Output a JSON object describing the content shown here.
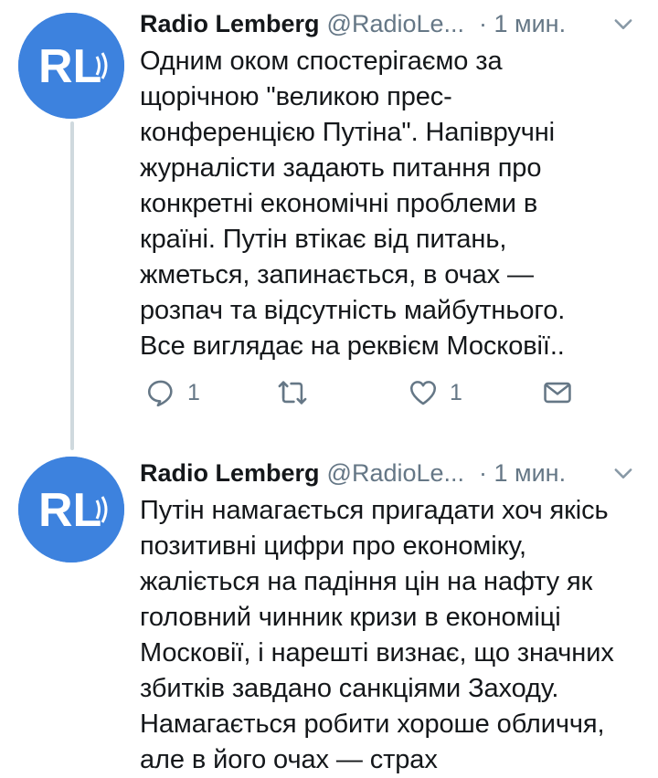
{
  "tweets": [
    {
      "avatar_text": "RL",
      "name": "Radio Lemberg",
      "handle": "@RadioLe...",
      "time": "· 1 мин.",
      "text": "Одним оком спостерігаємо за\nщорічною \"великою прес-\nконференцією Путіна\". Напівручні\nжурналісти задають питання про\nконкретні економічні проблеми в\nкраїні. Путін втікає від питань,\nжметься, запинається, в очах —\nрозпач та відсутність майбутнього.\nВсе виглядає на реквієм Московії..",
      "actions": {
        "reply_icon": "reply-icon",
        "reply_count": "1",
        "retweet_icon": "retweet-icon",
        "retweet_count": "",
        "like_icon": "like-icon",
        "like_count": "1",
        "dm_icon": "message-icon"
      }
    },
    {
      "avatar_text": "RL",
      "name": "Radio Lemberg",
      "handle": "@RadioLe...",
      "time": "· 1 мин.",
      "text": "Путін намагається пригадати хоч якісь\nпозитивні цифри про економіку,\nжаліється на падіння цін на нафту як\nголовний чинник кризи в економіці\nМосковії, і нарешті визнає, що значних\nзбитків завдано санкціями Заходу.\nНамагається робити хороше обличчя,\nале в його очах — страх"
    }
  ],
  "colors": {
    "avatar_bg": "#3d82de",
    "text": "#14171a",
    "secondary": "#657786",
    "thread_line": "#cfd9de"
  }
}
